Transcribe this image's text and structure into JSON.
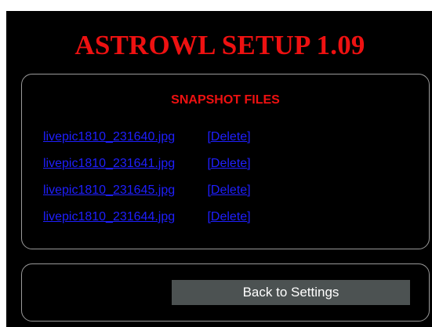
{
  "app": {
    "title": "ASTROWL SETUP 1.09"
  },
  "snapshots": {
    "heading": "SNAPSHOT FILES",
    "files": [
      {
        "name": "livepic1810_231640.jpg",
        "delete_label": "Delete"
      },
      {
        "name": "livepic1810_231641.jpg",
        "delete_label": "Delete"
      },
      {
        "name": "livepic1810_231645.jpg",
        "delete_label": "Delete"
      },
      {
        "name": "livepic1810_231644.jpg",
        "delete_label": "Delete"
      }
    ]
  },
  "navigation": {
    "back_label": "Back to Settings"
  },
  "colors": {
    "background": "#000000",
    "title_red": "#ee1111",
    "link_blue": "#1f1fff",
    "panel_border": "#9a9a9a",
    "button_bg": "#4c5252",
    "button_text": "#ffffff"
  }
}
